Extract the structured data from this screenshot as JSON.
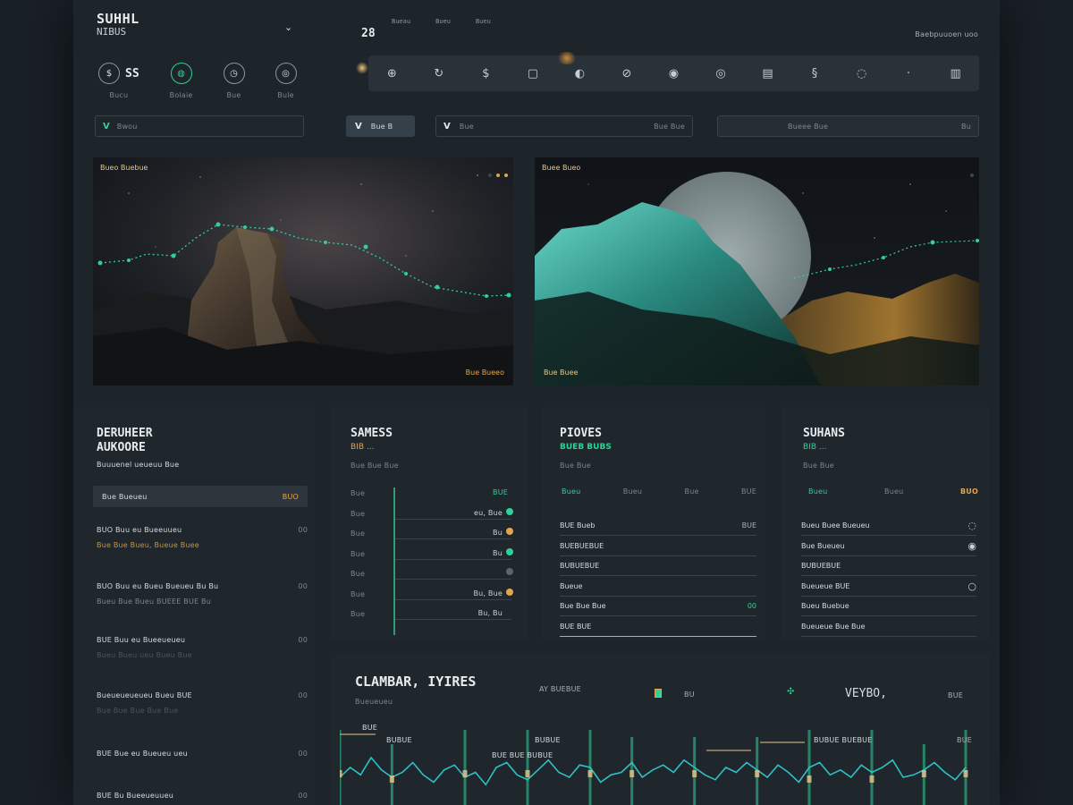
{
  "sidebar": {
    "title": "SUHHL",
    "subtitle": "NIBUS",
    "quick_items": [
      {
        "icon": "dollar-icon",
        "glyph": "$",
        "label": "Bucu"
      },
      {
        "icon": "globe-icon",
        "glyph": "◍",
        "label": "Bolaie"
      },
      {
        "icon": "clock-icon",
        "glyph": "◷",
        "label": "Bue"
      },
      {
        "icon": "target-icon",
        "glyph": "◎",
        "label": "Bule"
      }
    ],
    "quick_value": "SS",
    "select_label": "Bwou"
  },
  "header": {
    "date": "28",
    "mini_tabs": [
      "Bueau",
      "Bueu",
      "Bueu"
    ],
    "right_link": "Baebpuuoen uoo"
  },
  "toolbar": {
    "icons": [
      {
        "name": "globe-icon",
        "glyph": "⊕"
      },
      {
        "name": "refresh-icon",
        "glyph": "↻"
      },
      {
        "name": "dollar-icon",
        "glyph": "$"
      },
      {
        "name": "square-icon",
        "glyph": "▢"
      },
      {
        "name": "compass-icon",
        "glyph": "◐"
      },
      {
        "name": "link-icon",
        "glyph": "⊘"
      },
      {
        "name": "record-icon",
        "glyph": "◉"
      },
      {
        "name": "target-icon",
        "glyph": "◎"
      },
      {
        "name": "document-icon",
        "glyph": "▤"
      },
      {
        "name": "pin-icon",
        "glyph": "§"
      },
      {
        "name": "chat-icon",
        "glyph": "◌"
      },
      {
        "name": "dot-icon",
        "glyph": "·"
      },
      {
        "name": "file-icon",
        "glyph": "▥"
      }
    ]
  },
  "filters": {
    "button_label": "Bue B",
    "search_label": "Bue",
    "search_value": "Bue Bue",
    "right_label": "Bueee Bue",
    "right_value": "Bu"
  },
  "panels": [
    {
      "title": "Bueo Buebue",
      "footer": "Bue Bueeo",
      "dots": [
        "#3b4650",
        "#e5a54a",
        "#e5a54a"
      ]
    },
    {
      "title": "Buee Bueo",
      "footer": "Bue Buee",
      "dots": [
        "#3b4650"
      ]
    }
  ],
  "cards": {
    "audience": {
      "title1": "DERUHEER",
      "title2": "AUKOORE",
      "subtitle": "Buuuenel ueueuu Bue",
      "highlight_label": "Bue Bueueu",
      "highlight_value": "BUO",
      "rows": [
        {
          "title": "BUO Buu eu Bueeuueu",
          "sub": "Bue Bue Bueu, Bueue Buee",
          "value": "00"
        },
        {
          "title": "BUO Buu eu Bueu Bueueu Bu Bu",
          "sub": "Bueu Bue Bueu BUEEE BUE Bu",
          "value": "00"
        },
        {
          "title": "BUE Buu eu Bueeueueu",
          "sub": "Bueu Bueu ueu Bueu Bue",
          "value": "00"
        },
        {
          "title": "Bueueueueueu Bueu BUE",
          "sub": "Bue Bue Bue Bue Bue",
          "value": "00"
        },
        {
          "title": "BUE Bue eu Bueueu ueu",
          "sub": "",
          "value": "00"
        },
        {
          "title": "BUE Bu Bueeueuueu",
          "sub": "",
          "value": "00"
        }
      ]
    },
    "sales": {
      "title": "SAMESS",
      "value": "BIB ...",
      "caption": "Bue Bue Bue",
      "legend": "BUE",
      "axis_labels": [
        "Bue",
        "Bue",
        "Bue",
        "Bue",
        "Bue",
        "Bue",
        "Bue"
      ],
      "rows": [
        {
          "label": "eu, Bue",
          "dot": "#2fd19a"
        },
        {
          "label": "Bu",
          "dot": "#e5a54a"
        },
        {
          "label": "Bu",
          "dot": "#2fd19a"
        },
        {
          "label": "",
          "dot": "#5a656c"
        },
        {
          "label": "Bu, Bue",
          "dot": "#e5a54a"
        },
        {
          "label": "Bu, Bu",
          "dot": ""
        }
      ]
    },
    "pioves": {
      "title": "PIOVES",
      "subtitle": "BUEB BUBS",
      "caption": "Bue Bue",
      "headers": [
        "Bueu",
        "Bueu",
        "Bue",
        "BUE"
      ],
      "rows": [
        {
          "label": "BUE Bueb",
          "value": "BUE"
        },
        {
          "label": "BUEBUEBUE",
          "value": ""
        },
        {
          "label": "BUBUEBUE",
          "value": ""
        },
        {
          "label": "Bueue",
          "value": ""
        },
        {
          "label": "Bue Bue Bue",
          "value": "00"
        },
        {
          "label": "BUE BUE",
          "value": ""
        }
      ]
    },
    "suhans": {
      "title": "SUHANS",
      "subtitle": "BIB ...",
      "caption": "Bue Bue",
      "headers": [
        "Bueu",
        "Bueu",
        "BUO"
      ],
      "rows": [
        {
          "label": "Bueu Buee Bueueu",
          "icon": "chat-icon"
        },
        {
          "label": "Bue Bueueu",
          "icon": "record-icon"
        },
        {
          "label": "BUBUEBUE",
          "icon": ""
        },
        {
          "label": "Bueueue BUE",
          "icon": "circle-icon"
        },
        {
          "label": "Bueu Buebue",
          "icon": ""
        },
        {
          "label": "Bueueue Bue Bue",
          "icon": ""
        }
      ]
    }
  },
  "timeline": {
    "title": "CLAMBAR, IYIRES",
    "subtitle": "Bueueueu",
    "top_labels": [
      "AY BUEBUE",
      "BU",
      "BU",
      "VEYBO,",
      "BUE"
    ],
    "chart_labels": [
      "BUE",
      "BUBUE",
      "BUE BUE BUBUE",
      "BUBUE",
      "BUBUE BUEBUE",
      "BUE"
    ],
    "colors": {
      "line": "#2fbfc4",
      "bar": "#2fd19a",
      "accent": "#e8c68c"
    }
  }
}
